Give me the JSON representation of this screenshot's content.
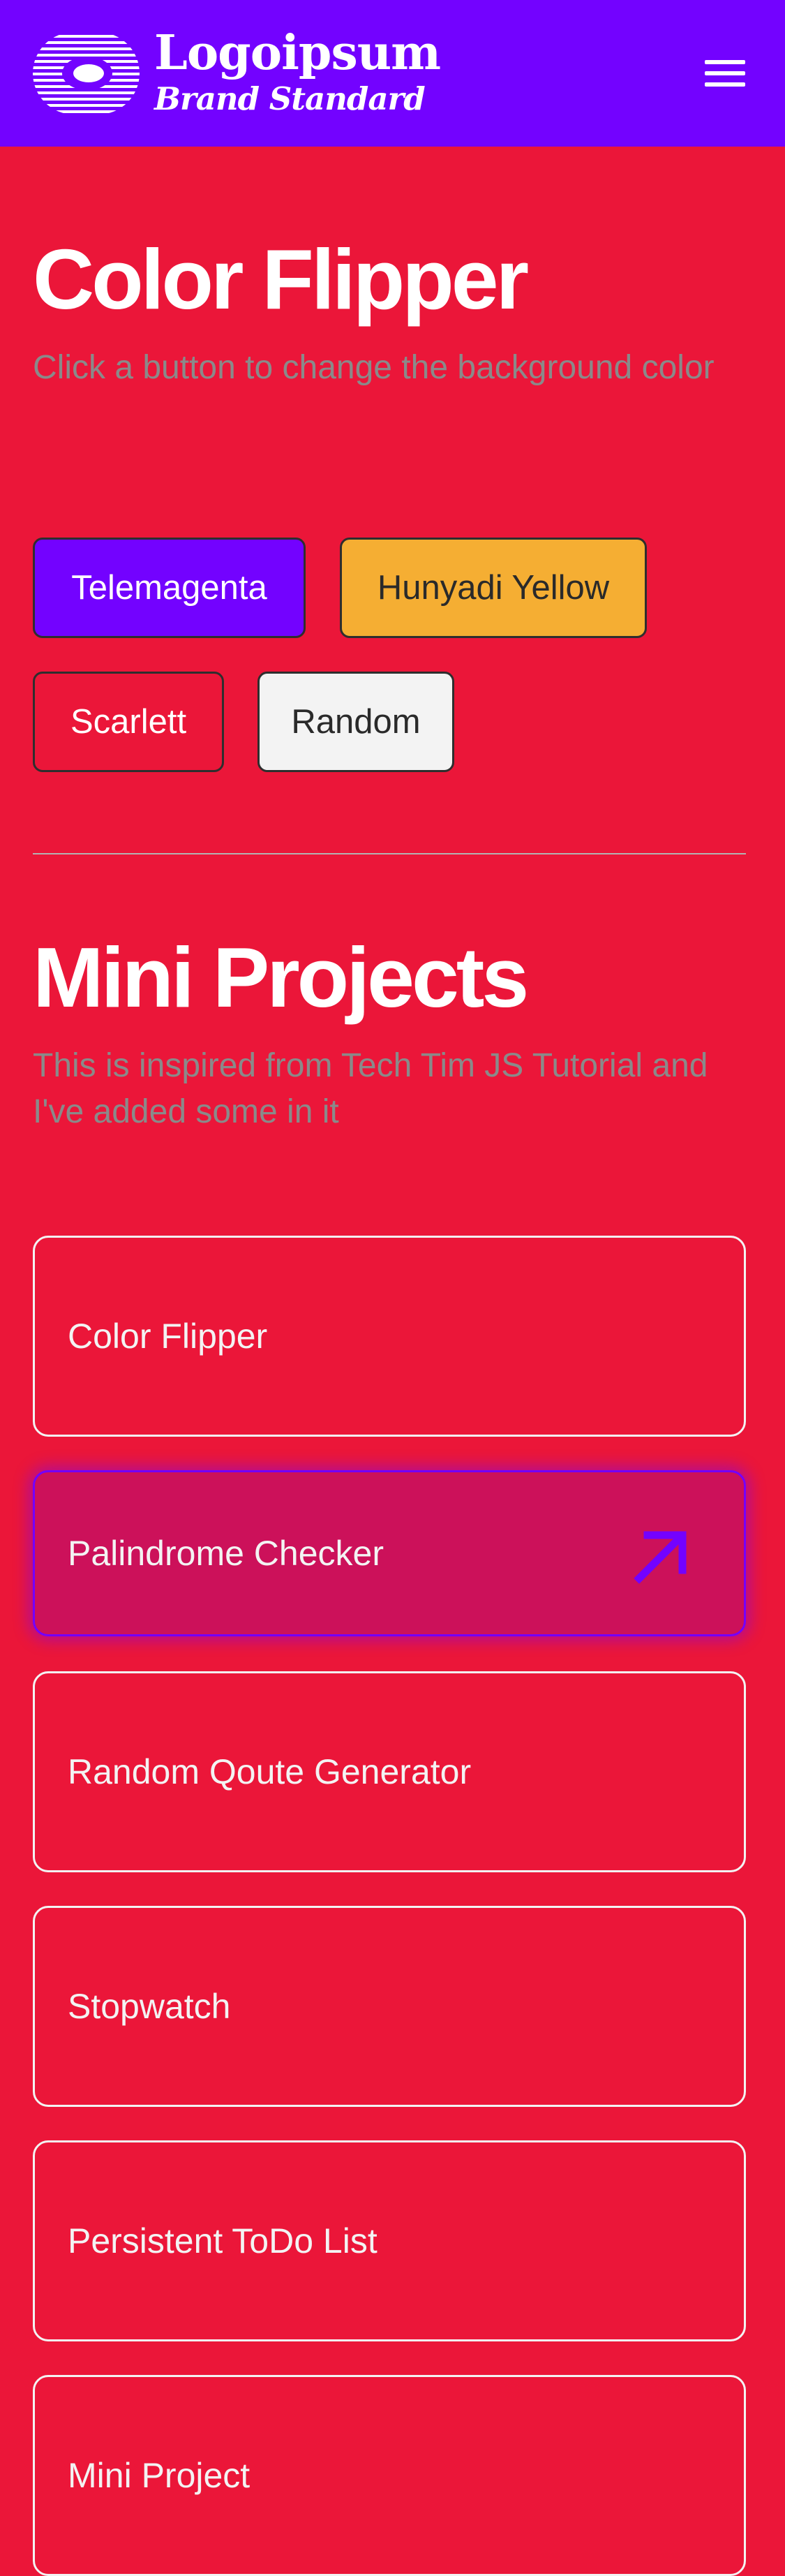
{
  "header": {
    "brand_name": "Logoipsum",
    "brand_tagline": "Brand Standard",
    "logo_icon": "striped-circle-logo-icon",
    "menu_icon": "hamburger-menu-icon",
    "background": "#7302FF"
  },
  "color_flipper": {
    "title": "Color Flipper",
    "subtitle": "Click a button to change the background color",
    "buttons": [
      {
        "label": "Telemagenta",
        "color": "#7302FF",
        "text_color": "#FFFFFF"
      },
      {
        "label": "Hunyadi Yellow",
        "color": "#F5AE33",
        "text_color": "#2A2A2A"
      },
      {
        "label": "Scarlett",
        "color": "#EB1639",
        "text_color": "#FFFFFF"
      },
      {
        "label": "Random",
        "color": "#F3F3F3",
        "text_color": "#2A2A2A"
      }
    ]
  },
  "mini_projects": {
    "title": "Mini Projects",
    "subtitle": "This is inspired from Tech Tim JS Tutorial and I've added some in it",
    "items": [
      {
        "label": "Color Flipper"
      },
      {
        "label": "Palindrome Checker",
        "icon": "arrow-up-right-icon"
      },
      {
        "label": "Random Qoute Generator"
      },
      {
        "label": "Stopwatch"
      },
      {
        "label": "Persistent ToDo List"
      },
      {
        "label": "Mini Project"
      }
    ]
  },
  "colors": {
    "page_background": "#EB1639",
    "accent": "#7302FF",
    "hover_card": "#CC115A",
    "subtitle_text": "#8A8A8A",
    "light_text": "#F3F3F3"
  }
}
